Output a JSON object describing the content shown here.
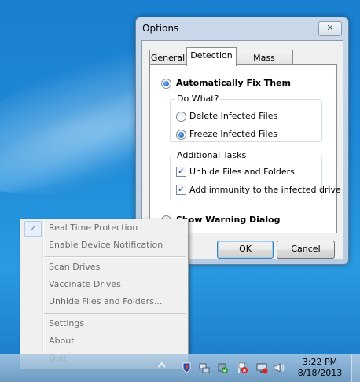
{
  "window": {
    "title": "Options",
    "close_glyph": "✕",
    "tabs": [
      {
        "label": "General",
        "active": false
      },
      {
        "label": "Detection",
        "active": true
      },
      {
        "label": "Mass Storage",
        "active": false
      }
    ],
    "detection": {
      "auto_fix_label": "Automatically Fix Them",
      "auto_fix_selected": true,
      "do_what_title": "Do What?",
      "delete_label": "Delete Infected Files",
      "freeze_label": "Freeze Infected Files",
      "freeze_selected": true,
      "additional_title": "Additional Tasks",
      "unhide_label": "Unhide Files and Folders",
      "unhide_checked": true,
      "immunity_label": "Add immunity to the infected drive",
      "immunity_checked": true,
      "warning_label": "Show Warning Dialog",
      "warning_selected": false
    },
    "ok_label": "OK",
    "cancel_label": "Cancel"
  },
  "menu": {
    "check_glyph": "✓",
    "items": [
      {
        "label": "Real Time Protection",
        "checked": true
      },
      {
        "label": "Enable Device Notification"
      },
      {
        "label": "Scan Drives"
      },
      {
        "label": "Vaccinate Drives"
      },
      {
        "label": "Unhide Files and Folders..."
      },
      {
        "label": "Settings"
      },
      {
        "label": "About"
      },
      {
        "label": "Quit"
      }
    ]
  },
  "taskbar": {
    "tray_icons": [
      "shield-flag-icon",
      "network-icon",
      "security-check-icon",
      "action-center-icon",
      "monitor-icon",
      "volume-icon"
    ],
    "time": "3:22 PM",
    "date": "8/18/2013"
  }
}
